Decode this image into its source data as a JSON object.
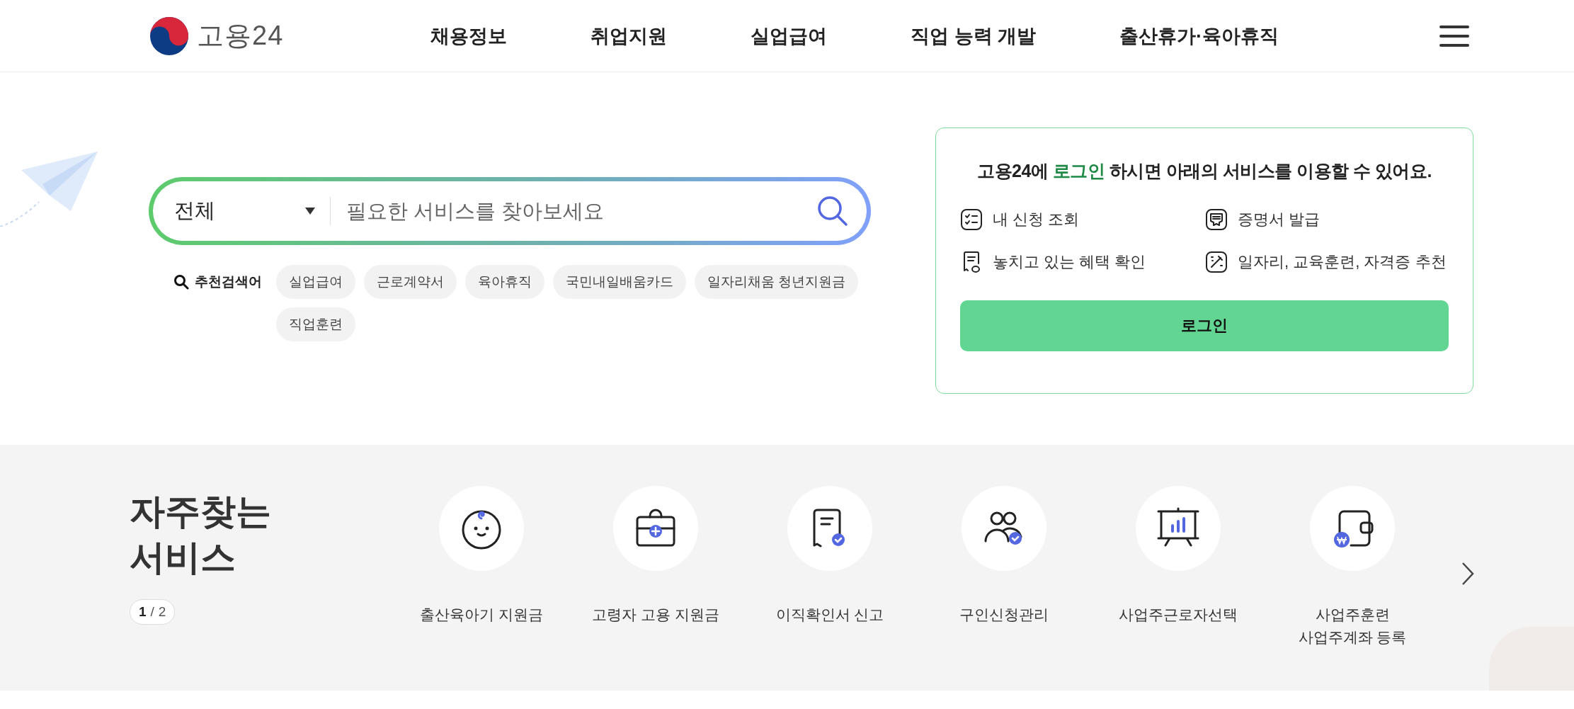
{
  "header": {
    "logo": "고용24",
    "nav": [
      "채용정보",
      "취업지원",
      "실업급여",
      "직업 능력 개발",
      "출산휴가·육아휴직"
    ]
  },
  "search": {
    "category": "전체",
    "placeholder": "필요한 서비스를 찾아보세요"
  },
  "recommended": {
    "label": "추천검색어",
    "keywords": [
      "실업급여",
      "근로계약서",
      "육아휴직",
      "국민내일배움카드",
      "일자리채움 청년지원금",
      "직업훈련"
    ]
  },
  "login_card": {
    "message": "고용24에 **로그인** 하시면 아래의 서비스를 이용할 수 있어요.",
    "features": [
      {
        "label": "내 신청 조회",
        "kind": "checklist"
      },
      {
        "label": "증명서 발급",
        "kind": "certificate"
      },
      {
        "label": "놓치고 있는 혜택 확인",
        "kind": "receipt"
      },
      {
        "label": "일자리, 교육훈련, 자격증 추천",
        "kind": "wand"
      }
    ],
    "button": "로그인"
  },
  "frequent_services": {
    "title": "자주찾는\n서비스",
    "pager": {
      "current": "1",
      "separator": "/",
      "total": "2"
    },
    "items": [
      {
        "label": "출산육아기 지원금",
        "kind": "baby"
      },
      {
        "label": "고령자 고용 지원금",
        "kind": "briefcase"
      },
      {
        "label": "이직확인서 신고",
        "kind": "document"
      },
      {
        "label": "구인신청관리",
        "kind": "people"
      },
      {
        "label": "사업주근로자선택",
        "kind": "chart"
      },
      {
        "label": "사업주훈련\n사업주계좌 등록",
        "kind": "wallet"
      }
    ]
  }
}
